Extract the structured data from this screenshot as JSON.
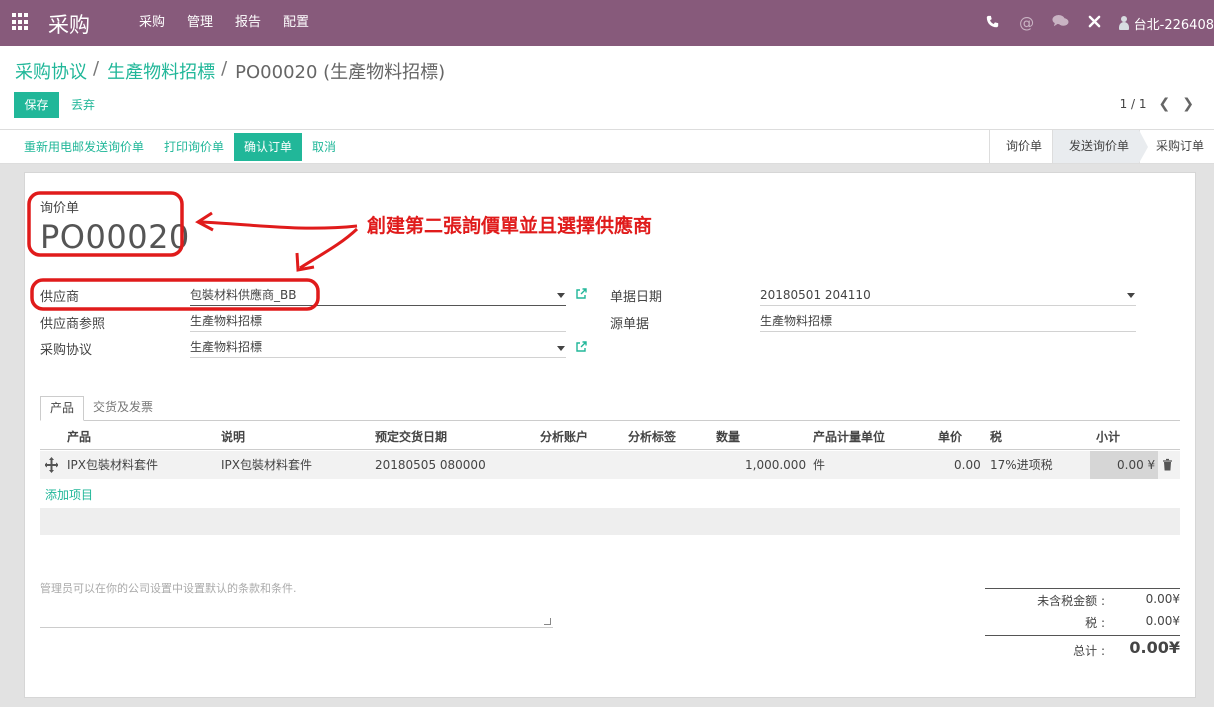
{
  "topbar": {
    "app_title": "采购",
    "menu": [
      "采购",
      "管理",
      "报告",
      "配置"
    ],
    "user_name": "台北-226408",
    "icons": [
      "apps-icon",
      "phone-icon",
      "at-icon",
      "chat-icon",
      "close-tools-icon",
      "avatar"
    ]
  },
  "breadcrumb": {
    "items": [
      "采购协议",
      "生產物料招標"
    ],
    "current": "PO00020 (生產物料招標)",
    "separator": "/"
  },
  "actions": {
    "save": "保存",
    "discard": "丢弃"
  },
  "pager": {
    "value": "1 / 1"
  },
  "header_buttons": [
    "重新用电邮发送询价单",
    "打印询价单",
    "确认订单",
    "取消"
  ],
  "statusbar": {
    "stages": [
      "询价单",
      "发送询价单",
      "采购订单"
    ],
    "active_stage": "发送询价单"
  },
  "form": {
    "doc_label": "询价单",
    "doc_number": "PO00020",
    "fields": {
      "vendor": {
        "label": "供应商",
        "value": "包裝材料供應商_BB"
      },
      "vendor_ref": {
        "label": "供应商参照",
        "value": "生產物料招標"
      },
      "purchase_agreement": {
        "label": "采购协议",
        "value": "生產物料招標"
      },
      "date_order": {
        "label": "单据日期",
        "value": "20180501 204110"
      },
      "origin": {
        "label": "源单据",
        "value": "生產物料招標"
      }
    }
  },
  "tabs": [
    "产品",
    "交货及发票"
  ],
  "order_lines": {
    "columns": [
      "产品",
      "说明",
      "预定交货日期",
      "分析账户",
      "分析标签",
      "数量",
      "产品计量单位",
      "单价",
      "税",
      "小计"
    ],
    "rows": [
      {
        "product": "IPX包裝材料套件",
        "description": "IPX包裝材料套件",
        "date_planned": "20180505 080000",
        "analytic_account": "",
        "analytic_tags": "",
        "quantity": "1,000.000",
        "uom": "件",
        "price_unit": "0.00",
        "taxes": "17%进项税",
        "subtotal": "0.00 ¥"
      }
    ],
    "add_line": "添加项目"
  },
  "notes_placeholder": "管理员可以在你的公司设置中设置默认的条款和条件.",
  "totals": {
    "untaxed_label": "未含税金额 :",
    "untaxed_value": "0.00¥",
    "tax_label": "税 :",
    "tax_value": "0.00¥",
    "total_label": "总计 :",
    "total_value": "0.00¥"
  },
  "annotation": {
    "text": "創建第二張詢價單並且選擇供應商",
    "color": "#e01b1b"
  },
  "colors": {
    "brand": "#875a7b",
    "accent": "#21b799"
  }
}
